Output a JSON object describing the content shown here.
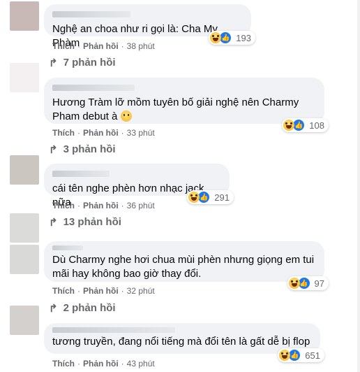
{
  "actions": {
    "like": "Thích",
    "reply": "Phản hồi",
    "sep": "·"
  },
  "comments": [
    {
      "text": "Nghệ an choa như ri gọi là: Cha My Phàm",
      "reactions": "193",
      "time": "38 phút",
      "replies": "7 phản hồi",
      "avatar_color": "#c9b9b6"
    },
    {
      "text": "Hương Tràm lỡ mồm tuyên bố giải nghệ nên Charmy Pham debut à",
      "emoji": "thinking-face",
      "reactions": "108",
      "time": "33 phút",
      "replies": "3 phản hồi",
      "avatar_color": "#f2eeee"
    },
    {
      "text": "cái tên nghe phèn hơn nhạc jack nữa",
      "reactions": "291",
      "time": "36 phút",
      "replies": "13 phản hồi",
      "avatar_color": "#c8c3be"
    },
    {
      "text": "Dù Charmy nghe hơi chua mùi phèn nhưng giọng em tui mãi hay không bao giờ thay đổi.",
      "reactions": "97",
      "time": "32 phút",
      "replies": "2 phản hồi",
      "avatar_color": "#d7d7d5"
    },
    {
      "text": "tương truyền, đang nổi tiếng mà đổi tên là gất dễ bị flop",
      "reactions": "651",
      "time": "43 phút",
      "avatar_color": "#d2cfcd"
    }
  ]
}
